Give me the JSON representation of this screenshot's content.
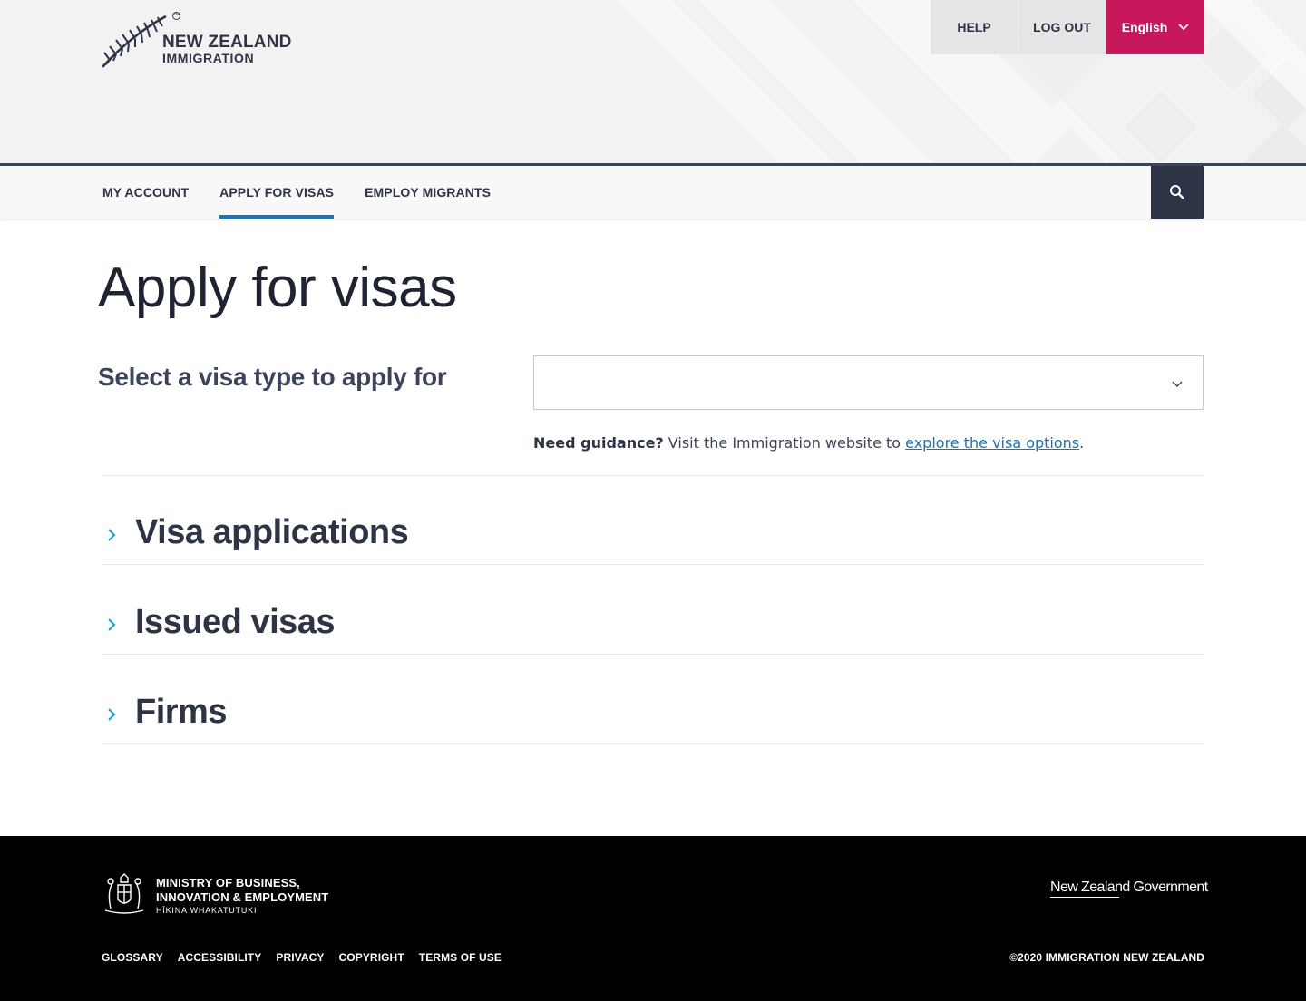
{
  "header": {
    "logo": {
      "line1": "NEW ZEALAND",
      "line2": "IMMIGRATION",
      "icon": "silver-fern-icon"
    },
    "utility_nav": {
      "help": "HELP",
      "logout": "LOG OUT",
      "language": "English"
    }
  },
  "primary_nav": {
    "items": [
      {
        "label": "MY ACCOUNT",
        "active": false
      },
      {
        "label": "APPLY FOR VISAS",
        "active": true
      },
      {
        "label": "EMPLOY MIGRANTS",
        "active": false
      }
    ],
    "search_icon": "search-icon"
  },
  "main": {
    "title": "Apply for visas",
    "select_label": "Select a visa type to apply for",
    "select_value": "",
    "guidance": {
      "bold": "Need guidance?",
      "text": " Visit the Immigration website to ",
      "link": "explore the visa options",
      "end": "."
    },
    "sections": [
      {
        "title": "Visa applications"
      },
      {
        "title": "Issued visas"
      },
      {
        "title": "Firms"
      }
    ]
  },
  "footer": {
    "mbie": {
      "line1": "MINISTRY OF BUSINESS,",
      "line2": "INNOVATION & EMPLOYMENT",
      "line3": "HĪKINA WHAKATUTUKI"
    },
    "nz_government": "New Zealand Government",
    "links": [
      "GLOSSARY",
      "ACCESSIBILITY",
      "PRIVACY",
      "COPYRIGHT",
      "TERMS OF USE"
    ],
    "copyright": "©2020 IMMIGRATION NEW ZEALAND"
  },
  "colors": {
    "accent_blue": "#0e76bc",
    "language_button": "#c7185c",
    "dark_navy": "#2d3446",
    "chevron_cyan": "#1a9bd7"
  }
}
